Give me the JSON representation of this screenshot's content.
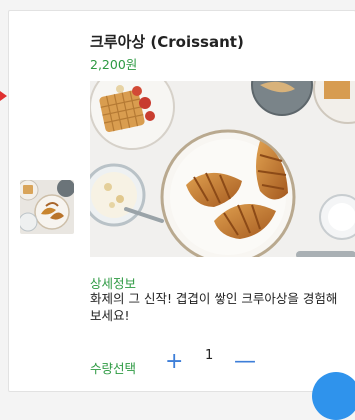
{
  "product": {
    "title": "크루아상 (Croissant)",
    "price": "2,200원",
    "image_icon": "croissant-breakfast-photo"
  },
  "details": {
    "label": "상세정보",
    "description": "화제의 그 신작! 겹겹이 쌓인 크루아상을 경험해보세요!"
  },
  "quantity": {
    "label": "수량선택",
    "plus_symbol": "+",
    "value": "1",
    "minus_symbol": "—"
  },
  "colors": {
    "accent_green": "#2e9a43",
    "accent_blue": "#3d7ed8",
    "fab_blue": "#2f93ec"
  }
}
